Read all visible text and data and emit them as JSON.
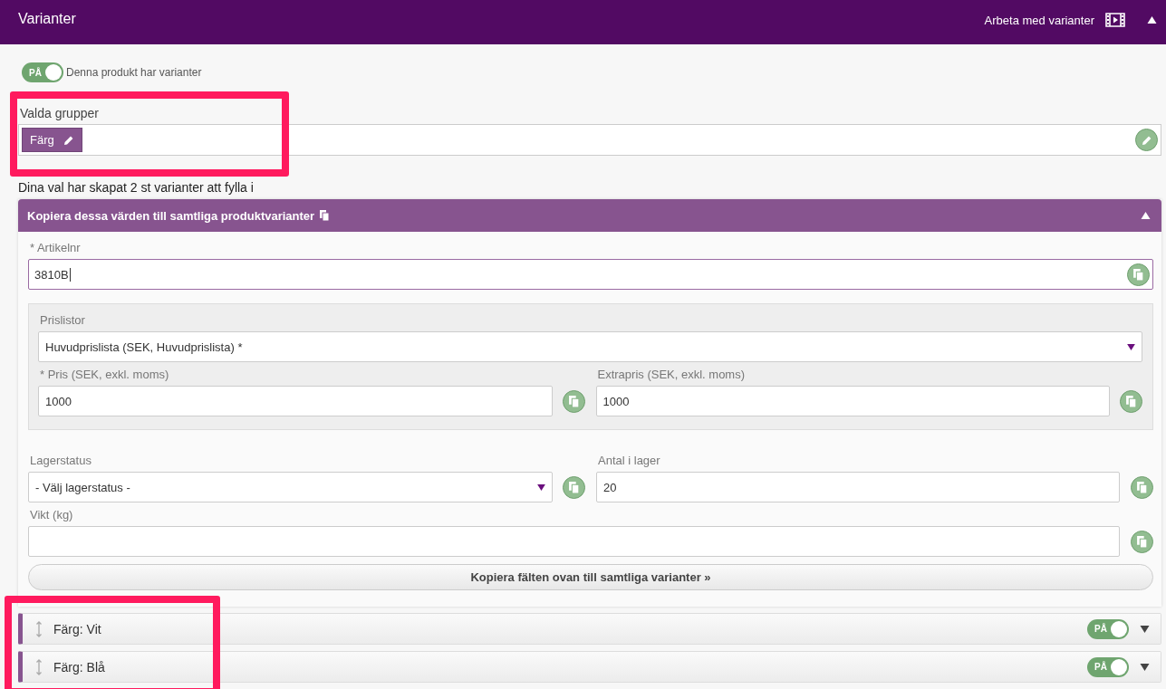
{
  "header": {
    "title": "Varianter",
    "link": "Arbeta med varianter",
    "expanded": true
  },
  "variants_toggle": {
    "on": true,
    "on_label": "PÅ",
    "label": "Denna produkt har varianter"
  },
  "groups": {
    "label": "Valda grupper",
    "tags": [
      "Färg"
    ]
  },
  "summary": "Dina val har skapat 2 st varianter att fylla i",
  "copy_panel": {
    "title": "Kopiera dessa värden till samtliga produktvarianter",
    "expanded": true,
    "article": {
      "required_mark": "*",
      "label": "Artikelnr",
      "value": "3810B"
    },
    "pricelist": {
      "label": "Prislistor",
      "value": "Huvudprislista (SEK, Huvudprislista) *"
    },
    "price": {
      "required_mark": "*",
      "label": "Pris (SEK, exkl. moms)",
      "value": "1000"
    },
    "extra_price": {
      "label": "Extrapris (SEK, exkl. moms)",
      "value": "1000"
    },
    "stock_status": {
      "label": "Lagerstatus",
      "value": "- Välj lagerstatus -"
    },
    "stock_qty": {
      "label": "Antal i lager",
      "value": "20"
    },
    "weight": {
      "label": "Vikt (kg)"
    },
    "copy_button": "Kopiera fälten ovan till samtliga varianter »"
  },
  "variants": [
    {
      "label": "Färg: Vit",
      "on": true,
      "on_label": "PÅ",
      "expanded": false
    },
    {
      "label": "Färg: Blå",
      "on": true,
      "on_label": "PÅ",
      "expanded": false
    }
  ]
}
